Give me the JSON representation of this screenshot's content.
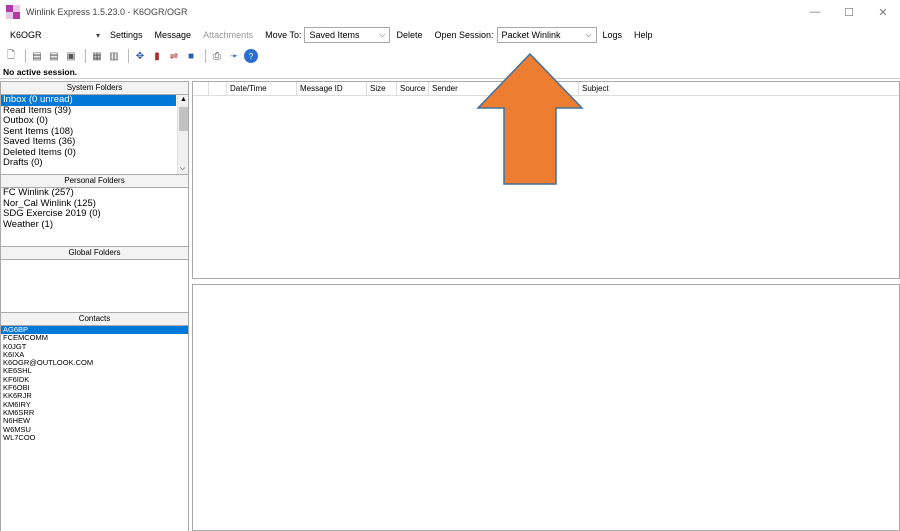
{
  "window": {
    "title": "Winlink Express 1.5.23.0 - K6OGR/OGR",
    "minimize": "—",
    "maximize": "☐",
    "close": "✕"
  },
  "menubar": {
    "callsign": "K6OGR",
    "settings": "Settings",
    "message": "Message",
    "attachments": "Attachments",
    "move_to_label": "Move To:",
    "move_to_value": "Saved Items",
    "delete": "Delete",
    "open_session_label": "Open Session:",
    "open_session_value": "Packet Winlink",
    "logs": "Logs",
    "help": "Help"
  },
  "status": {
    "session": "No active session."
  },
  "system_folders": {
    "header": "System Folders",
    "items": [
      "Inbox (0 unread)",
      "Read Items (39)",
      "Outbox (0)",
      "Sent Items (108)",
      "Saved Items (36)",
      "Deleted Items (0)",
      "Drafts (0)"
    ]
  },
  "personal_folders": {
    "header": "Personal Folders",
    "items": [
      "FC Winlink (257)",
      "Nor_Cal Winlink (125)",
      "SDG Exercise 2019 (0)",
      "Weather (1)"
    ]
  },
  "global_folders": {
    "header": "Global Folders"
  },
  "contacts": {
    "header": "Contacts",
    "items": [
      "AG6BP",
      "FCEMCOMM",
      "K0JGT",
      "K6IXA",
      "K6OGR@OUTLOOK.COM",
      "KE6SHL",
      "KF6IDK",
      "KF6OBI",
      "KK6RJR",
      "KM6IRY",
      "KM6SRR",
      "N6HEW",
      "W6MSU",
      "WL7COO"
    ]
  },
  "message_list": {
    "columns": [
      "Date/Time",
      "Message ID",
      "Size",
      "Source",
      "Sender",
      "",
      "Subject"
    ]
  },
  "colors": {
    "selection": "#0078d7",
    "arrow_fill": "#ed7d31",
    "arrow_stroke": "#41719c"
  }
}
